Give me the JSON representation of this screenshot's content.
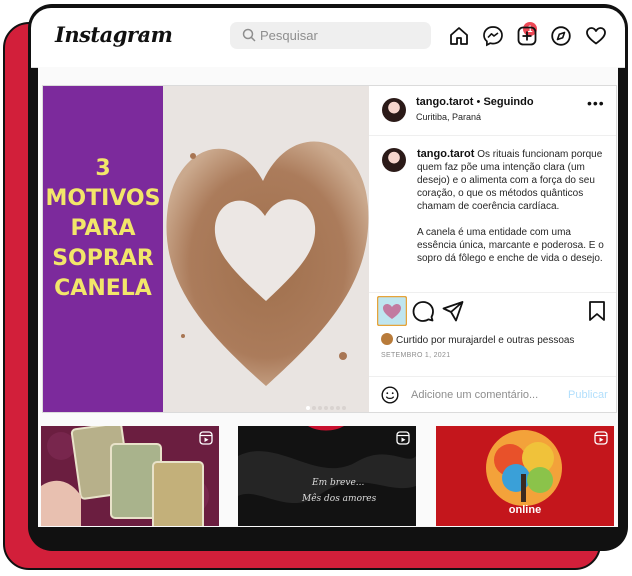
{
  "header": {
    "logo": "Instagram",
    "search_placeholder": "Pesquisar",
    "notification_count": "1",
    "nav_icons": [
      "home-icon",
      "messenger-icon",
      "new-post-icon",
      "explore-icon",
      "activity-heart-icon"
    ]
  },
  "post": {
    "slide_title": "3 MOTIVOS PARA SOPRAR CANELA",
    "slide_count": 7,
    "active_slide": 1,
    "username": "tango.tarot",
    "separator": "•",
    "follow_status": "Seguindo",
    "location": "Curitiba, Paraná",
    "more": "•••",
    "caption_username": "tango.tarot",
    "caption_p1": "Os rituais funcionam porque quem faz põe uma intenção clara (um desejo) e o alimenta com a força do seu coração, o que os métodos quânticos chamam de coerência cardíaca.",
    "caption_p2": "A canela é uma entidade com uma essência única, marcante e poderosa. E o sopro dá fôlego e enche de vida o desejo.",
    "liked_prefix": "Curtido por ",
    "liked_user": "murajardel",
    "liked_suffix": " e outras pessoas",
    "date": "SETEMBRO 1, 2021",
    "comment_placeholder": "Adicione um comentário...",
    "publish_label": "Publicar",
    "liked": true
  },
  "grid": {
    "thumb2_line1": "Em breve...",
    "thumb2_line2": "Mês dos amores",
    "thumb3_label": "online"
  },
  "colors": {
    "accent_red": "#d21f3a",
    "slide_purple": "#7c2a9c",
    "slide_text": "#f2e66a",
    "badge": "#ed4956",
    "publish": "#b2dffc"
  }
}
